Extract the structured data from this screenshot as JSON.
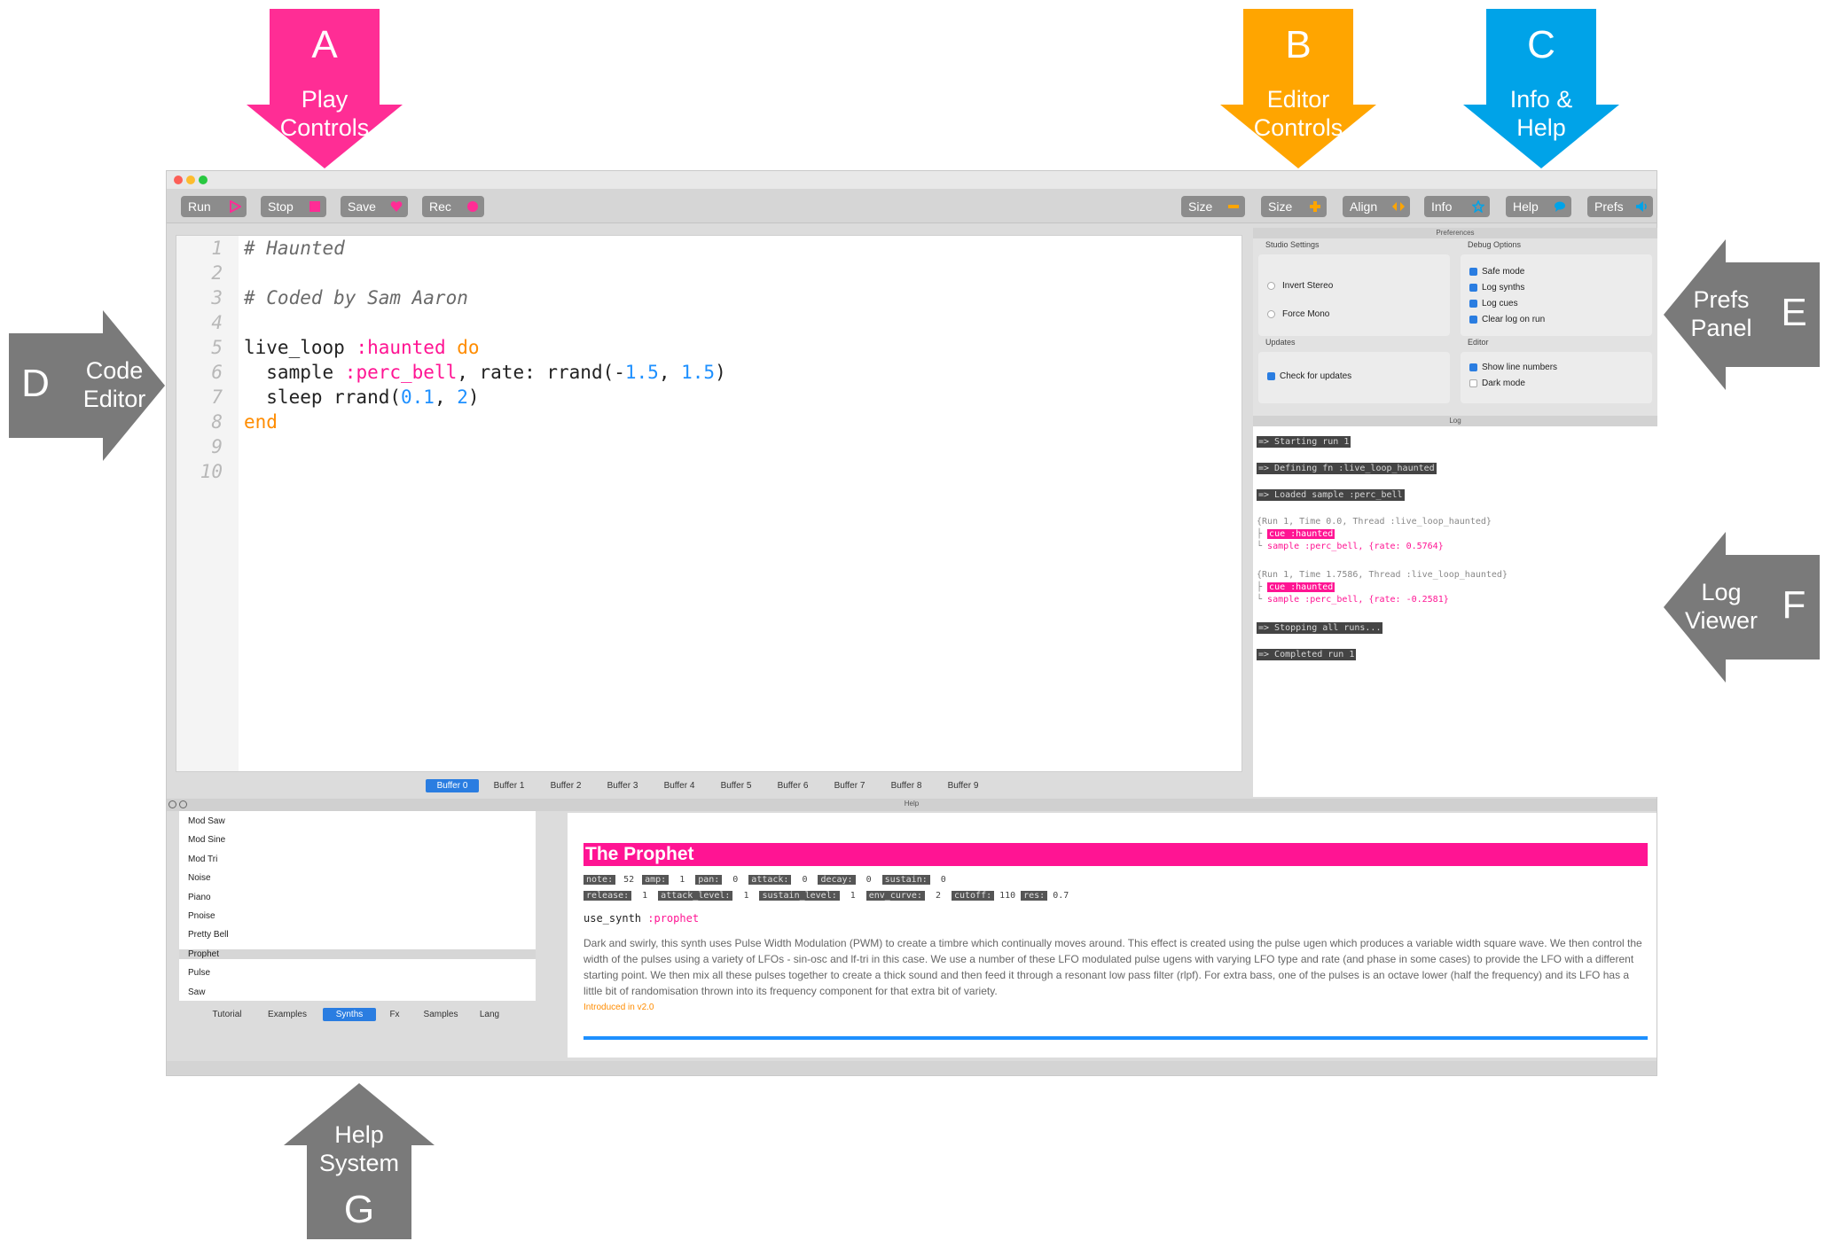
{
  "callouts": {
    "a": {
      "letter": "A",
      "line1": "Play",
      "line2": "Controls",
      "color": "#ff2d95"
    },
    "b": {
      "letter": "B",
      "line1": "Editor",
      "line2": "Controls",
      "color": "#ffa500"
    },
    "c": {
      "letter": "C",
      "line1": "Info &",
      "line2": "Help",
      "color": "#00a3e8"
    },
    "d": {
      "letter": "D",
      "line1": "Code",
      "line2": "Editor",
      "color": "#7a7a7a"
    },
    "e": {
      "letter": "E",
      "line1": "Prefs",
      "line2": "Panel",
      "color": "#7a7a7a"
    },
    "f": {
      "letter": "F",
      "line1": "Log",
      "line2": "Viewer",
      "color": "#7a7a7a"
    },
    "g": {
      "letter": "G",
      "line1": "Help",
      "line2": "System",
      "color": "#7a7a7a"
    }
  },
  "toolbar": {
    "play": [
      {
        "label": "Run",
        "icon": "play-icon",
        "icon_color": "#ff2d95"
      },
      {
        "label": "Stop",
        "icon": "stop-icon",
        "icon_color": "#ff2d95"
      },
      {
        "label": "Save",
        "icon": "heart-icon",
        "icon_color": "#ff2d95"
      },
      {
        "label": "Rec",
        "icon": "record-icon",
        "icon_color": "#ff2d95"
      }
    ],
    "editor": [
      {
        "label": "Size",
        "icon": "minus-icon",
        "icon_color": "#ffa500"
      },
      {
        "label": "Size",
        "icon": "plus-icon",
        "icon_color": "#ffa500"
      },
      {
        "label": "Align",
        "icon": "align-icon",
        "icon_color": "#ffa500"
      }
    ],
    "help": [
      {
        "label": "Info",
        "icon": "star-icon",
        "icon_color": "#00a3e8"
      },
      {
        "label": "Help",
        "icon": "speech-bubble-icon",
        "icon_color": "#00a3e8"
      },
      {
        "label": "Prefs",
        "icon": "speaker-icon",
        "icon_color": "#00a3e8"
      }
    ]
  },
  "editor": {
    "line_numbers": [
      "1",
      "2",
      "3",
      "4",
      "5",
      "6",
      "7",
      "8",
      "9",
      "10"
    ],
    "code": {
      "l1": "# Haunted",
      "l3": "# Coded by Sam Aaron",
      "l5a": "live_loop ",
      "l5b": ":haunted",
      "l5c": " do",
      "l6a": "  sample ",
      "l6b": ":perc_bell",
      "l6c": ", rate: rrand(-",
      "l6d": "1.5",
      "l6e": ", ",
      "l6f": "1.5",
      "l6g": ")",
      "l7a": "  sleep rrand(",
      "l7b": "0.1",
      "l7c": ", ",
      "l7d": "2",
      "l7e": ")",
      "l8": "end"
    },
    "buffers": [
      "Buffer 0",
      "Buffer 1",
      "Buffer 2",
      "Buffer 3",
      "Buffer 4",
      "Buffer 5",
      "Buffer 6",
      "Buffer 7",
      "Buffer 8",
      "Buffer 9"
    ],
    "active_buffer": 0
  },
  "prefs": {
    "header": "Preferences",
    "studio_title": "Studio Settings",
    "invert_stereo": "Invert Stereo",
    "force_mono": "Force Mono",
    "debug_title": "Debug Options",
    "safe_mode": "Safe mode",
    "log_synths": "Log synths",
    "log_cues": "Log cues",
    "clear_log": "Clear log on run",
    "updates_title": "Updates",
    "check_updates": "Check for updates",
    "editor_title": "Editor",
    "show_line_numbers": "Show line numbers",
    "dark_mode": "Dark mode"
  },
  "log": {
    "header": "Log",
    "starting": "=> Starting run 1",
    "defining": "=> Defining fn :live_loop_haunted",
    "loaded": "=> Loaded sample :perc_bell",
    "run1_header": "{Run 1, Time 0.0, Thread :live_loop_haunted}",
    "run1_cue": "cue :haunted",
    "run1_sample": "sample :perc_bell, {rate: 0.5764}",
    "run2_header": "{Run 1, Time 1.7586, Thread :live_loop_haunted}",
    "run2_cue": "cue :haunted",
    "run2_sample": "sample :perc_bell, {rate: -0.2581}",
    "stopping": "=> Stopping all runs...",
    "completed": "=> Completed run 1"
  },
  "help": {
    "header": "Help",
    "synths": [
      "Mod Saw",
      "Mod Sine",
      "Mod Tri",
      "Noise",
      "Piano",
      "Pnoise",
      "Pretty Bell",
      "Prophet",
      "Pulse",
      "Saw"
    ],
    "selected_synth": 7,
    "tabs": [
      "Tutorial",
      "Examples",
      "Synths",
      "Fx",
      "Samples",
      "Lang"
    ],
    "active_tab": 2,
    "doc_title": "The Prophet",
    "args_row1": [
      {
        "k": "note:",
        "v": "52"
      },
      {
        "k": "amp:",
        "v": "1"
      },
      {
        "k": "pan:",
        "v": "0"
      },
      {
        "k": "attack:",
        "v": "0"
      },
      {
        "k": "decay:",
        "v": "0"
      },
      {
        "k": "sustain:",
        "v": "0"
      }
    ],
    "args_row2": [
      {
        "k": "release:",
        "v": "1"
      },
      {
        "k": "attack_level:",
        "v": "1"
      },
      {
        "k": "sustain_level:",
        "v": "1"
      },
      {
        "k": "env_curve:",
        "v": "2"
      },
      {
        "k": "cutoff:",
        "v": "110"
      },
      {
        "k": "res:",
        "v": "0.7"
      }
    ],
    "use_synth_a": "use_synth ",
    "use_synth_b": ":prophet",
    "description": "Dark and swirly, this synth uses Pulse Width Modulation (PWM) to create a timbre which continually moves around. This effect is created using the pulse ugen which produces a variable width square wave. We then control the width of the pulses using a variety of LFOs - sin-osc and lf-tri in this case. We use a number of these LFO modulated pulse ugens with varying LFO type and rate (and phase in some cases) to provide the LFO with a different starting point. We then mix all these pulses together to create a thick sound and then feed it through a resonant low pass filter (rlpf). For extra bass, one of the pulses is an octave lower (half the frequency) and its LFO has a little bit of randomisation thrown into its frequency component for that extra bit of variety.",
    "introduced": "Introduced in v2.0"
  }
}
